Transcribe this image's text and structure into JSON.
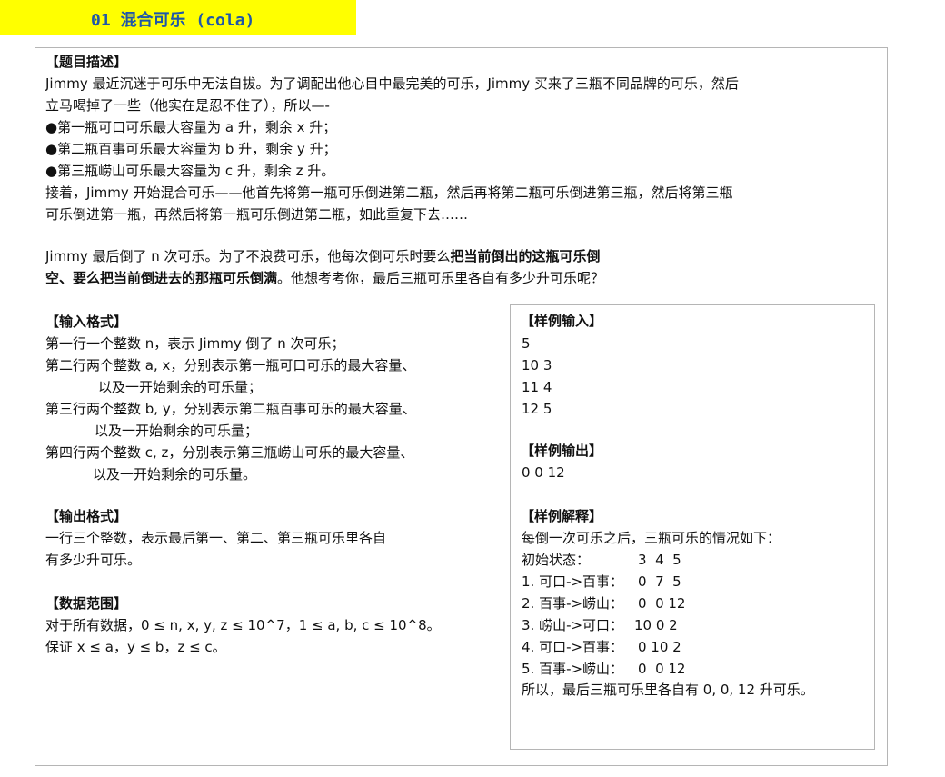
{
  "title": "01 混合可乐 (cola)",
  "description": {
    "heading": "【题目描述】",
    "p1_line1": "Jimmy 最近沉迷于可乐中无法自拔。为了调配出他心目中最完美的可乐，Jimmy 买来了三瓶不同品牌的可乐，然后",
    "p1_line2": "立马喝掉了一些（他实在是忍不住了），所以—-",
    "bullet_symbol": "●",
    "bullets": [
      "第一瓶可口可乐最大容量为 a 升，剩余 x 升；",
      "第二瓶百事可乐最大容量为 b 升，剩余 y 升；",
      "第三瓶崂山可乐最大容量为 c 升，剩余 z 升。"
    ],
    "p2_line1": "接着，Jimmy 开始混合可乐——他首先将第一瓶可乐倒进第二瓶，然后再将第二瓶可乐倒进第三瓶，然后将第三瓶",
    "p2_line2": "可乐倒进第一瓶，再然后将第一瓶可乐倒进第二瓶，如此重复下去……",
    "p3_line1_pre": "Jimmy 最后倒了 n 次可乐。为了不浪费可乐，他每次倒可乐时要么",
    "p3_line1_bold": "把当前倒出的这瓶可乐倒",
    "p3_line2_bold": "空、要么把当前倒进去的那瓶可乐倒满",
    "p3_line2_post": "。他想考考你，最后三瓶可乐里各自有多少升可乐呢？"
  },
  "input_format": {
    "heading": "【输入格式】",
    "lines": [
      "第一行一个整数 n，表示 Jimmy 倒了 n 次可乐；",
      "第二行两个整数 a, x，分别表示第一瓶可口可乐的最大容量、",
      "以及一开始剩余的可乐量；",
      "第三行两个整数 b, y，分别表示第二瓶百事可乐的最大容量、",
      "以及一开始剩余的可乐量；",
      "第四行两个整数 c, z，分别表示第三瓶崂山可乐的最大容量、",
      "以及一开始剩余的可乐量。"
    ]
  },
  "output_format": {
    "heading": "【输出格式】",
    "lines": [
      "一行三个整数，表示最后第一、第二、第三瓶可乐里各自",
      "有多少升可乐。"
    ]
  },
  "data_range": {
    "heading": "【数据范围】",
    "lines": [
      "对于所有数据，0 ≤ n, x, y, z ≤ 10^7，1 ≤ a, b, c ≤ 10^8。",
      "保证 x ≤ a，y ≤ b，z ≤ c。"
    ]
  },
  "sample_input": {
    "heading": "【样例输入】",
    "lines": [
      "5",
      "10 3",
      "11 4",
      "12 5"
    ]
  },
  "sample_output": {
    "heading": "【样例输出】",
    "lines": [
      "0 0 12"
    ]
  },
  "sample_explanation": {
    "heading": "【样例解释】",
    "intro": "每倒一次可乐之后，三瓶可乐的情况如下：",
    "steps": [
      {
        "label": "初始状态：",
        "value": "3  4  5"
      },
      {
        "label": "1. 可口->百事：",
        "value": "0  7  5"
      },
      {
        "label": "2. 百事->崂山：",
        "value": "0  0 12"
      },
      {
        "label": "3. 崂山->可口：",
        "value": "10 0 2"
      },
      {
        "label": "4. 可口->百事：",
        "value": "0 10 2"
      },
      {
        "label": "5. 百事->崂山：",
        "value": "0  0 12"
      }
    ],
    "conclusion": "所以，最后三瓶可乐里各自有 0, 0, 12 升可乐。"
  }
}
